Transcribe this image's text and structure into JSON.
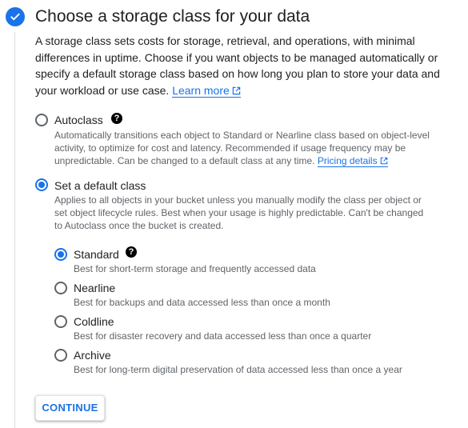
{
  "step": {
    "title": "Choose a storage class for your data",
    "status_icon": "check-circle-icon"
  },
  "intro": {
    "text": "A storage class sets costs for storage, retrieval, and operations, with minimal differences in uptime. Choose if you want objects to be managed automatically or specify a default storage class based on how long you plan to store your data and your workload or use case.",
    "learn_more": "Learn more"
  },
  "options": {
    "autoclass": {
      "label": "Autoclass",
      "checked": false,
      "description": "Automatically transitions each object to Standard or Nearline class based on object-level activity, to optimize for cost and latency. Recommended if usage frequency may be unpredictable. Can be changed to a default class at any time.",
      "pricing_link": "Pricing details"
    },
    "default_class": {
      "label": "Set a default class",
      "checked": true,
      "description": "Applies to all objects in your bucket unless you manually modify the class per object or set object lifecycle rules. Best when your usage is highly predictable. Can't be changed to Autoclass once the bucket is created."
    }
  },
  "classes": [
    {
      "label": "Standard",
      "description": "Best for short-term storage and frequently accessed data",
      "checked": true
    },
    {
      "label": "Nearline",
      "description": "Best for backups and data accessed less than once a month",
      "checked": false
    },
    {
      "label": "Coldline",
      "description": "Best for disaster recovery and data accessed less than once a quarter",
      "checked": false
    },
    {
      "label": "Archive",
      "description": "Best for long-term digital preservation of data accessed less than once a year",
      "checked": false
    }
  ],
  "continue_label": "CONTINUE",
  "colors": {
    "accent": "#1a73e8",
    "text": "#202124",
    "secondary_text": "#5f6368"
  }
}
